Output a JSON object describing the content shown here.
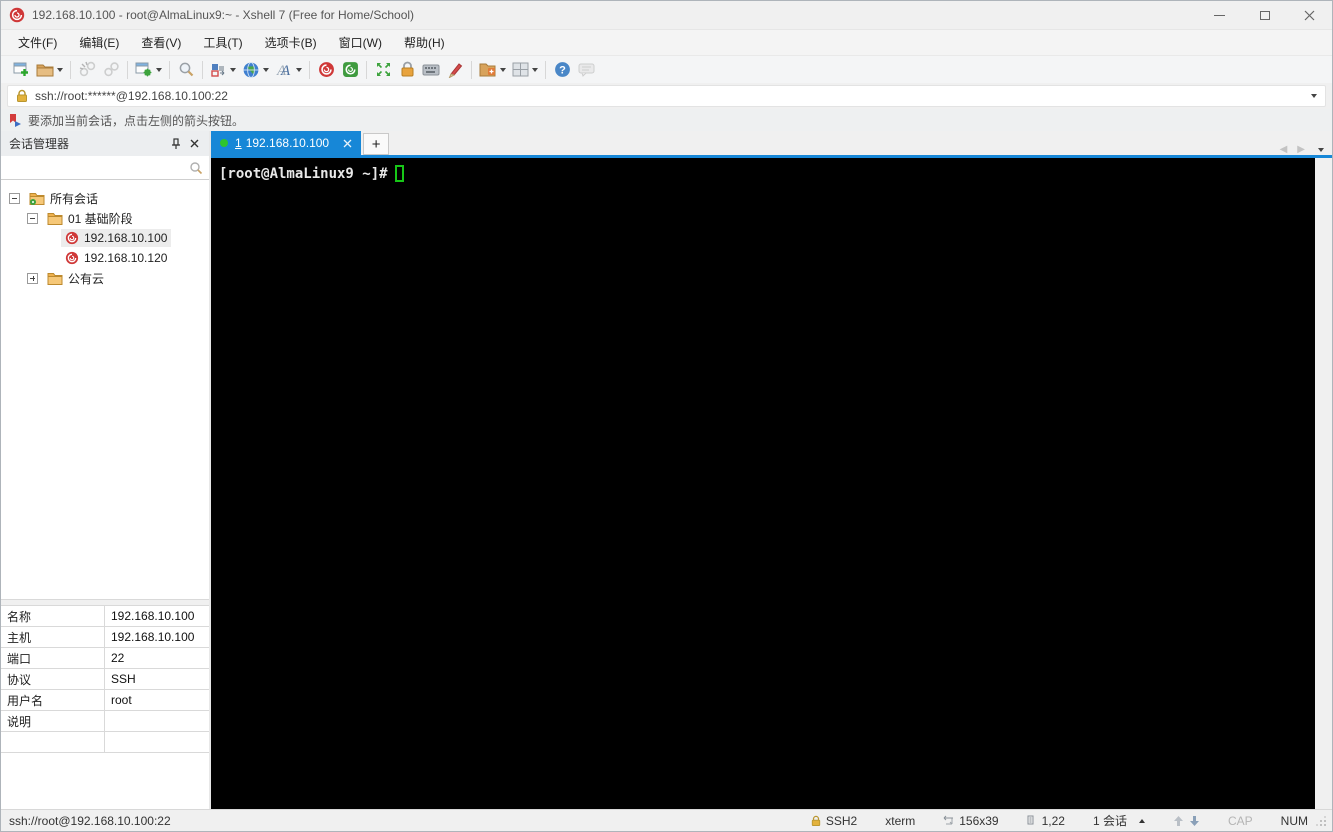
{
  "colors": {
    "accent": "#1787d7",
    "terminal_bg": "#000000",
    "cursor_green": "#17c617",
    "xshell_red": "#cf3838",
    "folder": "#f0a63c",
    "tab_dot_green": "#2ec52e"
  },
  "window": {
    "title": "192.168.10.100 - root@AlmaLinux9:~ - Xshell 7 (Free for Home/School)"
  },
  "menu": {
    "items": [
      "文件(F)",
      "编辑(E)",
      "查看(V)",
      "工具(T)",
      "选项卡(B)",
      "窗口(W)",
      "帮助(H)"
    ]
  },
  "toolbar": {
    "icons": [
      "new-session",
      "open-folder",
      "disconnect",
      "reconnect",
      "session-properties",
      "find",
      "compose",
      "encoding",
      "font",
      "xshell",
      "xftp",
      "fullscreen",
      "lock",
      "virtual-keyboard",
      "highlight",
      "new-folder",
      "layout",
      "help",
      "chat"
    ]
  },
  "address_bar": {
    "value": "ssh://root:******@192.168.10.100:22"
  },
  "info_bar": {
    "text": "要添加当前会话，点击左侧的箭头按钮。"
  },
  "session_manager": {
    "title": "会话管理器",
    "search_value": "",
    "tree": [
      {
        "label": "所有会话",
        "level": 0,
        "type": "root-folder",
        "expanded": true,
        "selected": false
      },
      {
        "label": "01 基础阶段",
        "level": 1,
        "type": "folder",
        "expanded": true,
        "selected": false
      },
      {
        "label": "192.168.10.100",
        "level": 2,
        "type": "session",
        "selected": true
      },
      {
        "label": "192.168.10.120",
        "level": 2,
        "type": "session",
        "selected": false
      },
      {
        "label": "公有云",
        "level": 1,
        "type": "folder",
        "expanded": false,
        "selected": false
      }
    ],
    "properties": [
      {
        "label": "名称",
        "value": "192.168.10.100"
      },
      {
        "label": "主机",
        "value": "192.168.10.100"
      },
      {
        "label": "端口",
        "value": "22"
      },
      {
        "label": "协议",
        "value": "SSH"
      },
      {
        "label": "用户名",
        "value": "root"
      },
      {
        "label": "说明",
        "value": ""
      }
    ]
  },
  "tabs": {
    "active": {
      "index": "1",
      "label": "192.168.10.100"
    },
    "new_tab_label": "+"
  },
  "terminal": {
    "prompt": "[root@AlmaLinux9 ~]#"
  },
  "status_bar": {
    "connection": "ssh://root@192.168.10.100:22",
    "protocol": "SSH2",
    "term_type": "xterm",
    "size": "156x39",
    "cursor_pos": "1,22",
    "session_count": "1 会话",
    "cap_label": "CAP",
    "num_label": "NUM"
  }
}
